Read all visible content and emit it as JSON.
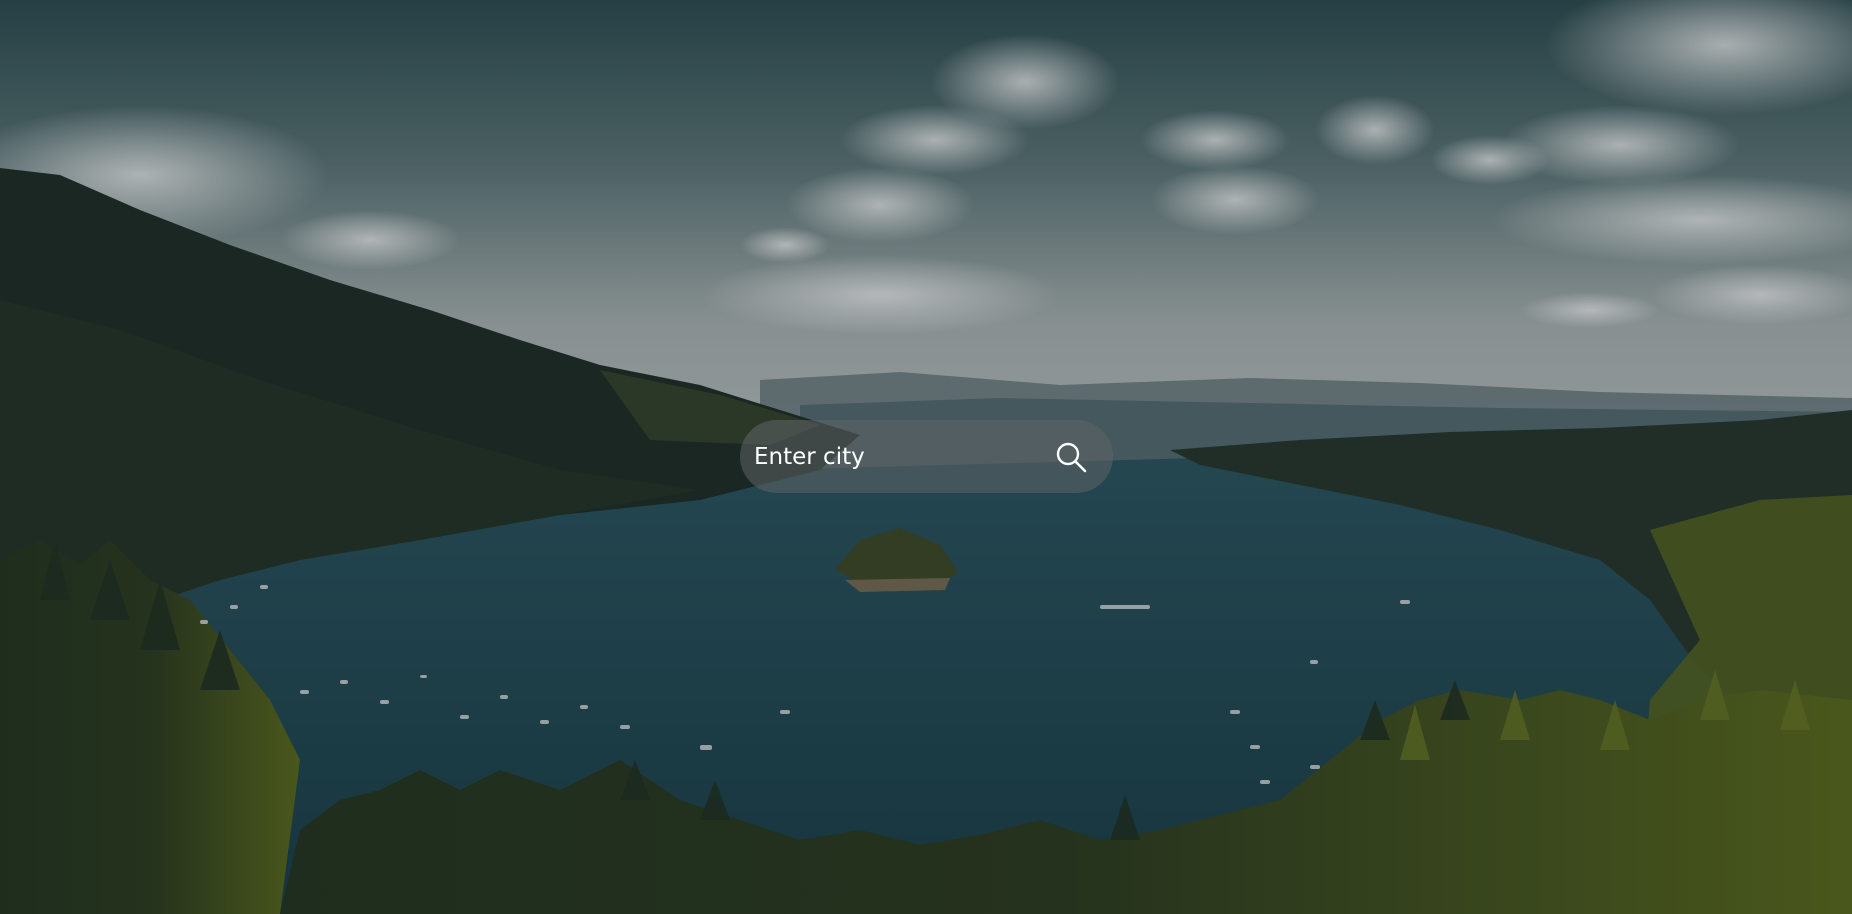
{
  "search": {
    "placeholder": "Enter city",
    "button_icon": "search-icon"
  },
  "background": {
    "scene": "lake-landscape",
    "colors": {
      "sky_top": "#2f5257",
      "sky_bottom": "#b9bfbf",
      "water": "#1f4a55",
      "forest_dark": "#1b2a22",
      "forest_light": "#5a6e1e"
    }
  }
}
